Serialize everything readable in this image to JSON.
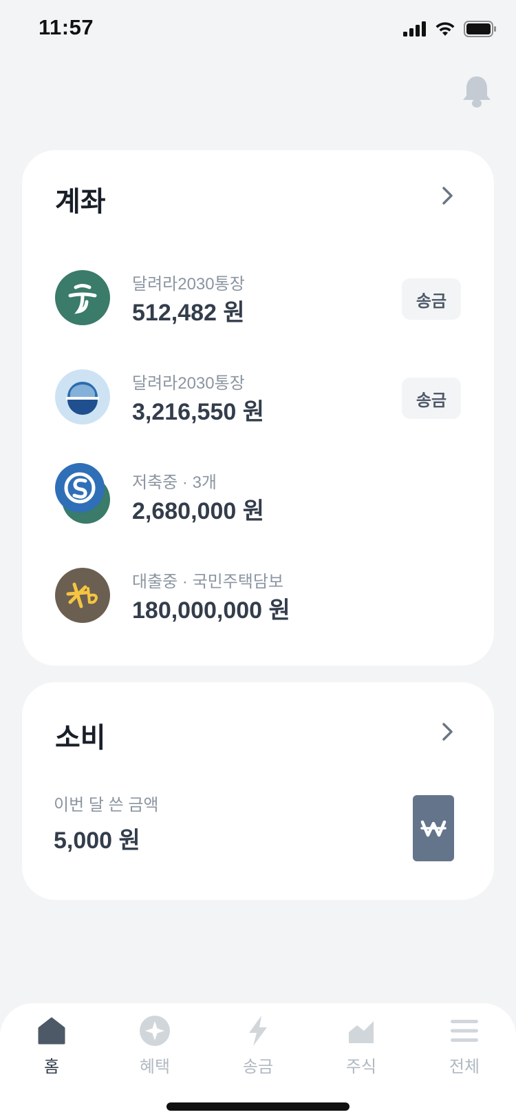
{
  "status": {
    "time": "11:57"
  },
  "accounts": {
    "title": "계좌",
    "items": [
      {
        "subtitle": "달려라2030통장",
        "amount": "512,482 원",
        "button": "송금",
        "logo": "hana-bank-logo"
      },
      {
        "subtitle": "달려라2030통장",
        "amount": "3,216,550 원",
        "button": "송금",
        "logo": "ibk-bank-logo"
      },
      {
        "subtitle": "저축중 · 3개",
        "amount": "2,680,000 원",
        "logo": "shinhan-bank-logo"
      },
      {
        "subtitle": "대출중 · 국민주택담보",
        "amount": "180,000,000 원",
        "logo": "kb-bank-logo"
      }
    ]
  },
  "spending": {
    "title": "소비",
    "subtitle": "이번 달 쓴 금액",
    "amount": "5,000 원",
    "icon": "won-icon"
  },
  "tabs": [
    {
      "label": "홈",
      "icon": "home-icon",
      "active": true
    },
    {
      "label": "혜택",
      "icon": "benefit-icon"
    },
    {
      "label": "송금",
      "icon": "lightning-icon"
    },
    {
      "label": "주식",
      "icon": "stock-chart-icon"
    },
    {
      "label": "전체",
      "icon": "menu-icon"
    }
  ],
  "colors": {
    "background": "#f2f4f6",
    "accent_slate": "#64748b",
    "hana": "#3a7b6a",
    "ibk_light": "#cde3f3",
    "shinhan": "#2f6fb7",
    "kb": "#6b5f51"
  }
}
